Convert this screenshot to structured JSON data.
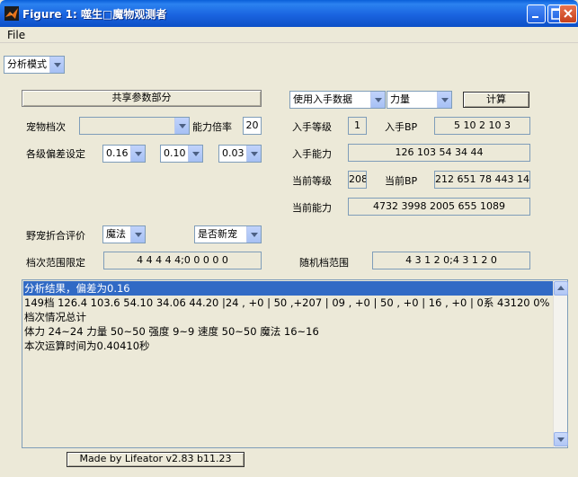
{
  "window": {
    "title": "Figure 1: 噬生□魔物观测者",
    "menu_file": "File"
  },
  "mode_select": {
    "value": "分析模式"
  },
  "shared": {
    "button_label": "共享参数部分",
    "pet_tier_label": "宠物档次",
    "pet_tier_value": "",
    "ability_mult_label": "能力倍率",
    "ability_mult_value": "20",
    "tier_dev_label": "各级偏差设定",
    "tier_dev_values": [
      "0.16",
      "0.10",
      "0.03"
    ]
  },
  "input": {
    "source_select": "使用入手数据",
    "stat_select": "力量",
    "calc_button": "计算",
    "level_label": "入手等级",
    "level_value": "1",
    "bp_label": "入手BP",
    "bp_value": "5 10 2 10 3",
    "ability_label": "入手能力",
    "ability_value": "126 103 54 34 44"
  },
  "current": {
    "level_label": "当前等级",
    "level_value": "208",
    "bp_label": "当前BP",
    "bp_value": "212 651 78 443 141",
    "ability_label": "当前能力",
    "ability_value": "4732 3998 2005 655 1089"
  },
  "wild": {
    "eval_label": "野宠折合评价",
    "method_select": "魔法",
    "new_pet_select": "是否新宠",
    "range_label": "档次范围限定",
    "range_value": "4 4 4 4 4;0 0 0 0 0",
    "random_label": "随机档范围",
    "random_value": "4 3 1 2 0;4 3 1 2 0"
  },
  "results": [
    "分析结果，偏差为0.16",
    "149档 126.4 103.6 54.10 34.06 44.20 |24 , +0 | 50 ,+207 | 09 , +0 | 50 , +0 | 16 , +0 | 0系 43120  0% *",
    "档次情况总计",
    "体力 24~24 力量 50~50 强度 9~9 速度 50~50 魔法 16~16",
    "本次运算时间为0.40410秒"
  ],
  "footer": {
    "made_by": "Made by Lifeator   v2.83 b11.23"
  }
}
